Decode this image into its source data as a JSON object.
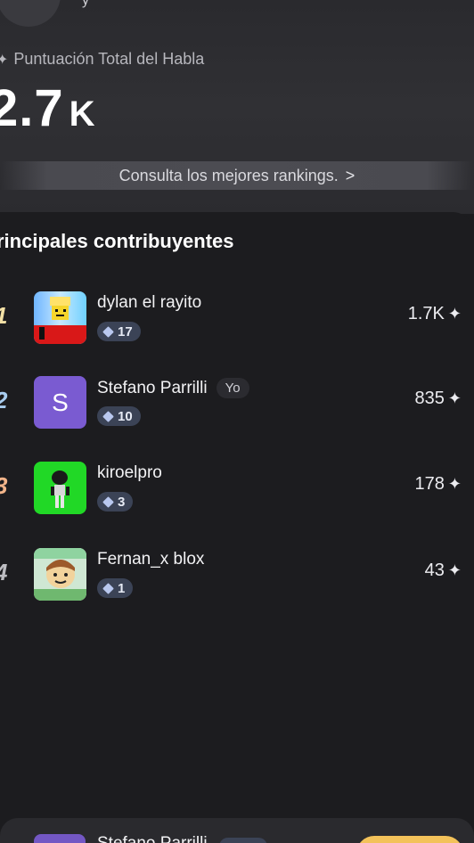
{
  "header": {
    "score_label": "Puntuación Total del Habla",
    "score_value": "2.7",
    "score_unit": "K",
    "rankings_link": "Consulta los mejores rankings.",
    "rankings_chevron": ">"
  },
  "contributors": {
    "title": "rincipales contribuyentes",
    "items": [
      {
        "rank": "1",
        "name": "dylan el rayito",
        "level": "17",
        "score": "1.7K",
        "avatar": "roblox-rainbow-avatar",
        "rank_color": "#f3e0a6"
      },
      {
        "rank": "2",
        "name": "Stefano Parrilli",
        "badge": "Yo",
        "level": "10",
        "score": "835",
        "avatar_letter": "S",
        "avatar_color": "#7a5bd1",
        "rank_color": "#a9cdf0"
      },
      {
        "rank": "3",
        "name": "kiroelpro",
        "level": "3",
        "score": "178",
        "avatar": "green-roblox-avatar",
        "avatar_color": "#21d826",
        "rank_color": "#f2b48a"
      },
      {
        "rank": "4",
        "name": "Fernan_x blox",
        "level": "1",
        "score": "43",
        "avatar": "noob-roblox-avatar",
        "rank_color": "#bdbdc2"
      }
    ]
  },
  "footer": {
    "name": "Stefano Parrilli"
  },
  "icons": {
    "sparkle": "✦"
  }
}
